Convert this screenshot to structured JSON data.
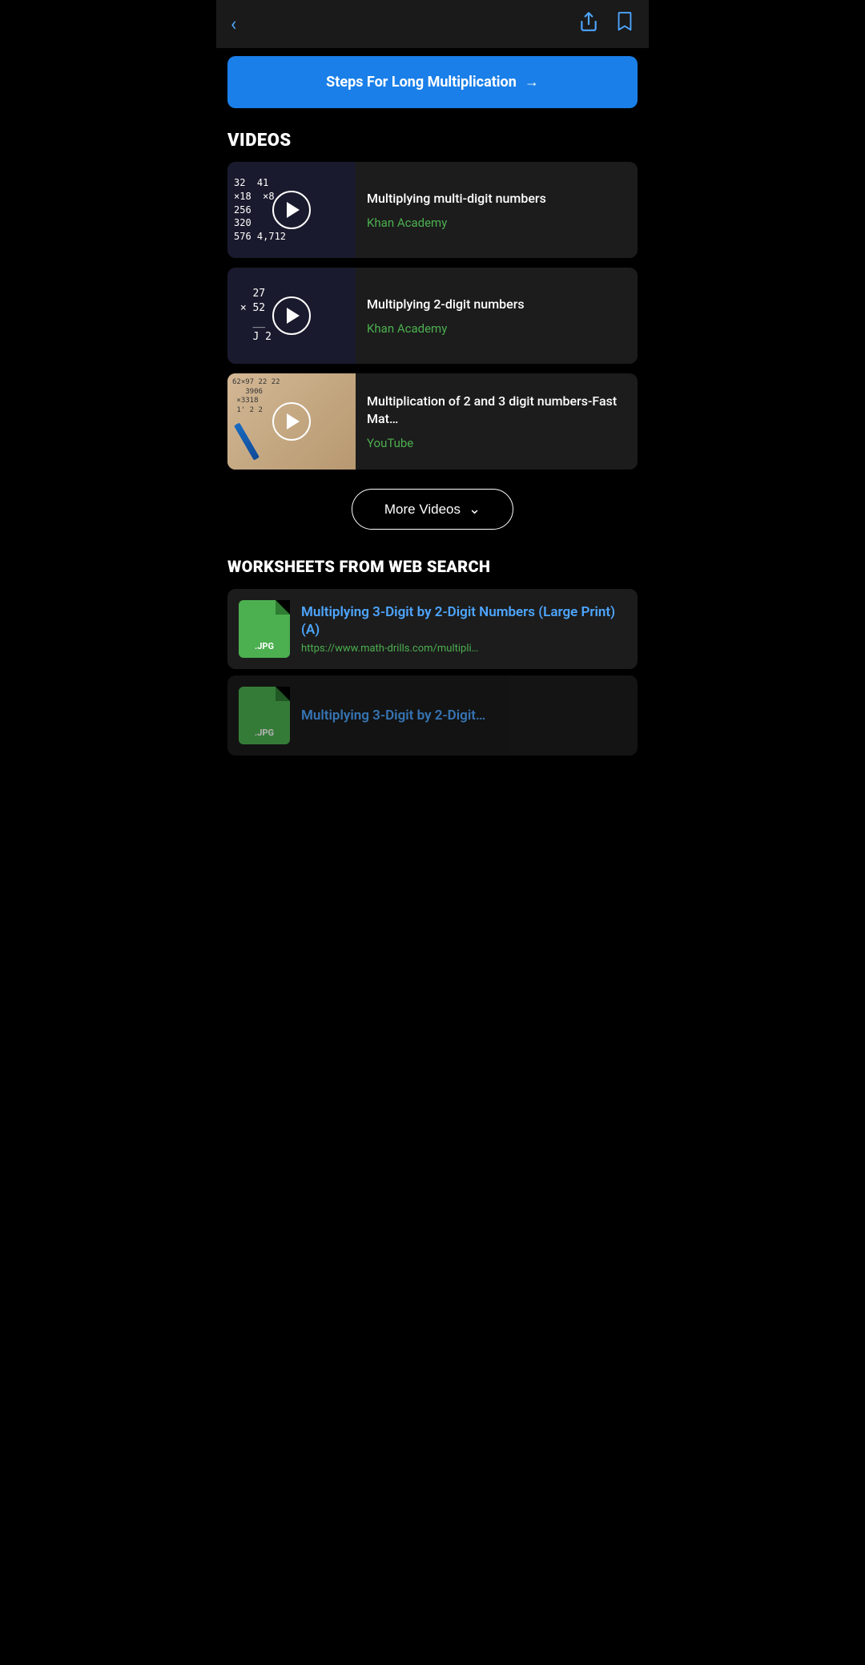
{
  "header": {
    "back_label": "‹",
    "share_icon": "share",
    "bookmark_icon": "bookmark"
  },
  "cta_button": {
    "label": "Steps For Long Multiplication",
    "arrow": "→"
  },
  "videos_section": {
    "title": "VIDEOS",
    "items": [
      {
        "id": "video-1",
        "title": "Multiplying multi-digit numbers",
        "source": "Khan Academy",
        "thumbnail_type": "math-1",
        "math_lines": [
          "  32    41",
          "×18    ×8",
          "256   ",
          "320   ",
          "576  4,712"
        ]
      },
      {
        "id": "video-2",
        "title": "Multiplying 2-digit numbers",
        "source": "Khan Academy",
        "thumbnail_type": "math-2",
        "math_lines": [
          "      27",
          "   ×  5 2",
          "     ___",
          "   J  2"
        ]
      },
      {
        "id": "video-3",
        "title": "Multiplication of 2 and 3 digit numbers-Fast Mat…",
        "source": "YouTube",
        "thumbnail_type": "math-3",
        "math_lines": [
          "62×97 22 22",
          "   3906",
          " ×3318",
          "1' 2 2"
        ]
      }
    ],
    "more_button": "More Videos"
  },
  "worksheets_section": {
    "title": "WORKSHEETS FROM WEB SEARCH",
    "items": [
      {
        "id": "ws-1",
        "file_type": ".JPG",
        "title": "Multiplying 3-Digit by 2-Digit Numbers (Large Print) (A)",
        "url": "https://www.math-drills.com/multipli…"
      },
      {
        "id": "ws-2",
        "file_type": ".JPG",
        "title": "Multiplying 3-Digit by 2-Digit…",
        "url": ""
      }
    ]
  }
}
